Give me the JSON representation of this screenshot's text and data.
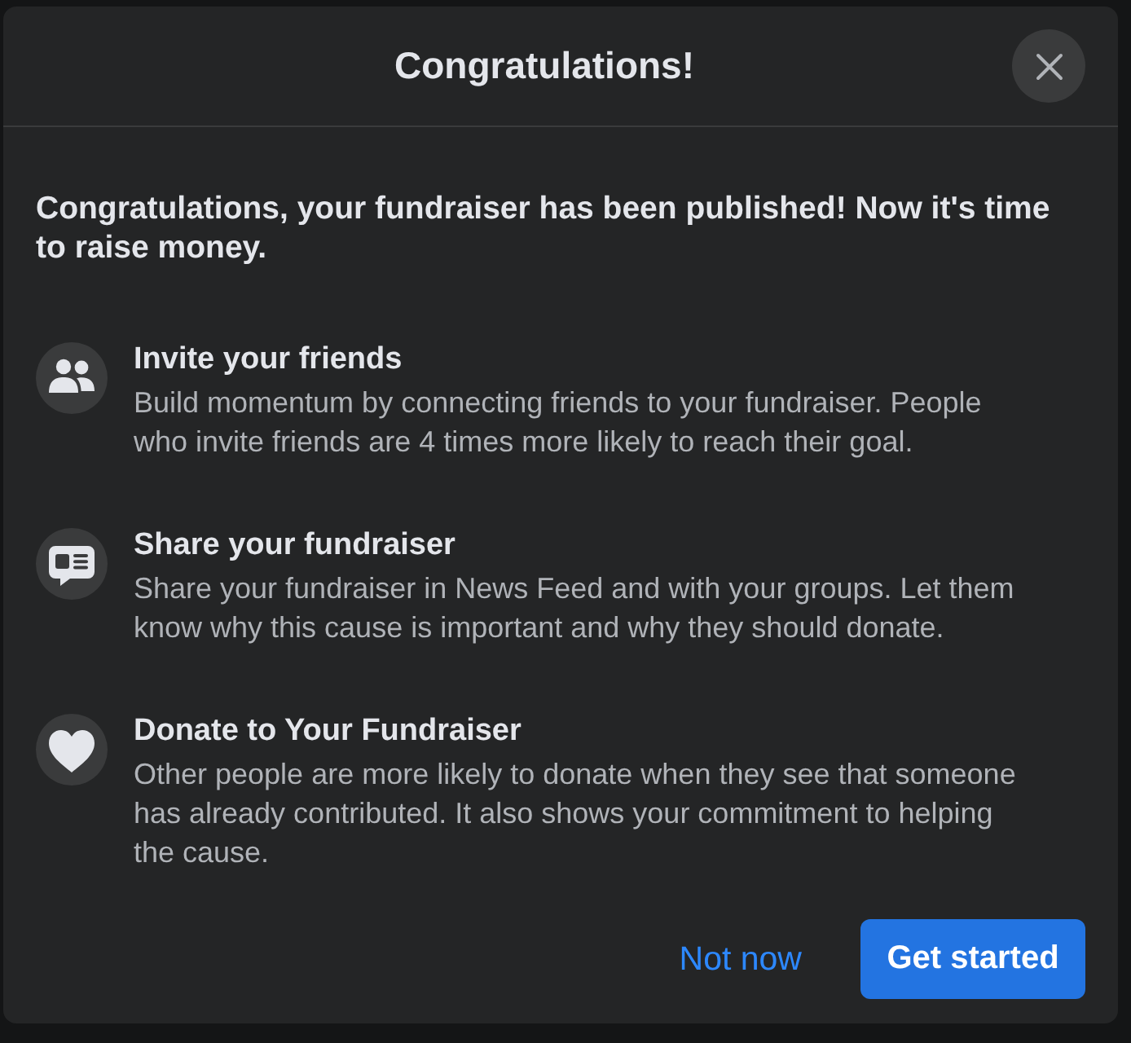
{
  "dialog": {
    "title": "Congratulations!",
    "message": "Congratulations, your fundraiser has been published! Now it's time to raise money.",
    "items": [
      {
        "kind": "friends",
        "title": "Invite your friends",
        "description": "Build momentum by connecting friends to your fundraiser. People who invite friends are 4 times more likely to reach their goal."
      },
      {
        "kind": "share",
        "title": "Share your fundraiser",
        "description": "Share your fundraiser in News Feed and with your groups. Let them know why this cause is important and why they should donate."
      },
      {
        "kind": "donate",
        "title": "Donate to Your Fundraiser",
        "description": "Other people are more likely to donate when they see that someone has already contributed. It also shows your commitment to helping the cause."
      }
    ],
    "buttons": [
      {
        "kind": "secondary",
        "label": "Not now"
      },
      {
        "kind": "primary",
        "label": "Get started"
      }
    ]
  }
}
